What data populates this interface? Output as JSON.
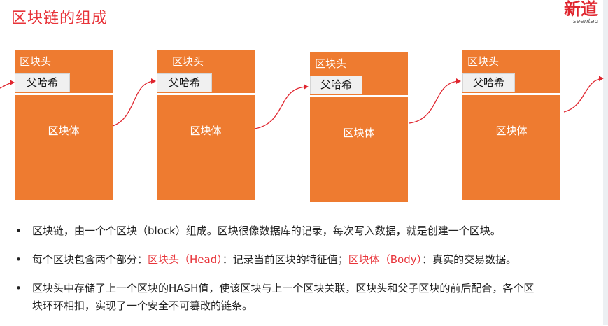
{
  "title": "区块链的组成",
  "logo": {
    "main": "新道",
    "sub": "seentao"
  },
  "blocks": [
    {
      "head": "区块头",
      "hash": "父哈希",
      "body": "区块体"
    },
    {
      "head": "区块头",
      "hash": "父哈希",
      "body": "区块体"
    },
    {
      "head": "区块头",
      "hash": "父哈希",
      "body": "区块体"
    },
    {
      "head": "区块头",
      "hash": "父哈希",
      "body": "区块体"
    }
  ],
  "bullets": {
    "b1": "区块链，由一个个区块（block）组成。区块很像数据库的记录，每次写入数据，就是创建一个区块。",
    "b2": {
      "pre": "每个区块包含两个部分：",
      "head": "区块头（Head）",
      "mid": "：记录当前区块的特征值；",
      "body": "区块体（Body）",
      "post": "：真实的交易数据。"
    },
    "b3_line1": "区块头中存储了上一个区块的HASH值，使该区块与上一个区块关联，区块头和父子区块的前后配合，各个区",
    "b3_line2": "块环环相扣，实现了一个安全不可篡改的链条。"
  },
  "colors": {
    "title": "#e8343a",
    "block": "#ee7b30",
    "arrow": "#e0262f",
    "highlight": "#e8343a"
  }
}
